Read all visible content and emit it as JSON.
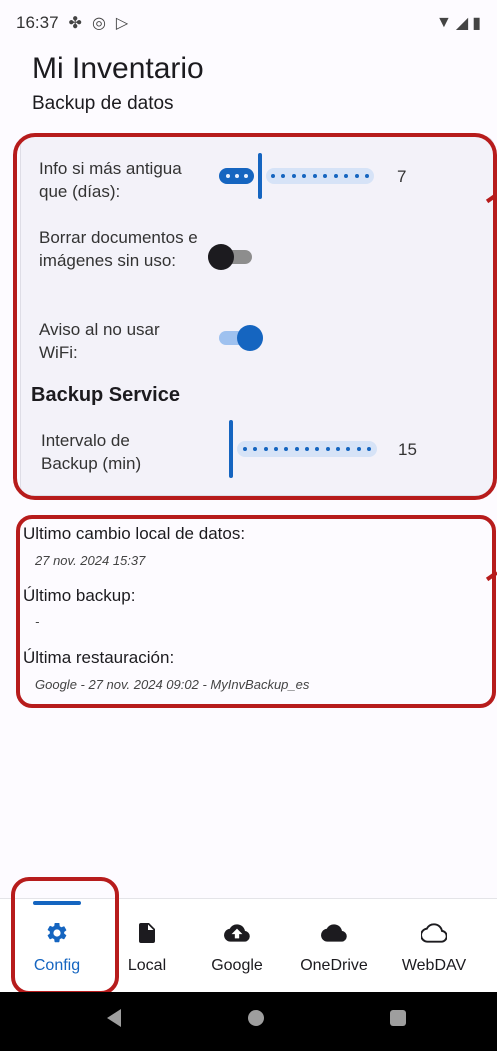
{
  "status_bar": {
    "time": "16:37",
    "left_icons": [
      "fan-icon",
      "at-icon",
      "play-icon"
    ],
    "right_icons": [
      "wifi-icon",
      "signal-icon",
      "battery-icon"
    ]
  },
  "app": {
    "title": "Mi Inventario",
    "subtitle": "Backup de datos"
  },
  "settings": {
    "info_older": {
      "label": "Info si más antigua que (días):",
      "value": "7"
    },
    "delete_unused": {
      "label": "Borrar documentos e imágenes sin uso:",
      "enabled": false
    },
    "warn_no_wifi": {
      "label": "Aviso al no usar WiFi:",
      "enabled": true
    },
    "backup_service_heading": "Backup Service",
    "backup_interval": {
      "label": "Intervalo de Backup (min)",
      "value": "15"
    }
  },
  "info": {
    "last_local_change_label": "Ultimo cambio local de datos:",
    "last_local_change_value": "27 nov. 2024 15:37",
    "last_backup_label": "Último backup:",
    "last_backup_value": "-",
    "last_restore_label": "Última restauración:",
    "last_restore_value": "Google - 27 nov. 2024 09:02 - MyInvBackup_es"
  },
  "bottom_nav": {
    "items": [
      {
        "label": "Config",
        "icon": "gear-icon",
        "active": true
      },
      {
        "label": "Local",
        "icon": "document-icon",
        "active": false
      },
      {
        "label": "Google",
        "icon": "cloud-upload-icon",
        "active": false
      },
      {
        "label": "OneDrive",
        "icon": "cloud-filled-icon",
        "active": false
      },
      {
        "label": "WebDAV",
        "icon": "cloud-outline-icon",
        "active": false
      }
    ]
  },
  "colors": {
    "accent": "#1565c0",
    "annotation": "#b71c1c",
    "card_background": "#f3f2f9"
  }
}
